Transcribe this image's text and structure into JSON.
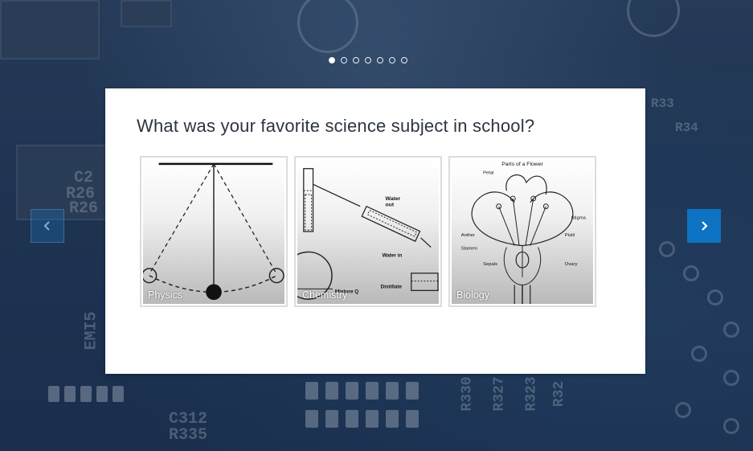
{
  "pager": {
    "count": 7,
    "active_index": 0
  },
  "question": {
    "text": "What was your favorite science subject in school?"
  },
  "choices": [
    {
      "label": "Physics",
      "image": "pendulum-diagram"
    },
    {
      "label": "Chemistry",
      "image": "distillation-apparatus-diagram"
    },
    {
      "label": "Biology",
      "image": "flower-parts-diagram"
    }
  ],
  "chemistry_diagram": {
    "water_out": "Water\nout",
    "water_in": "Water in",
    "distillate": "Distillate",
    "mixture": "Mixture Q"
  },
  "biology_diagram": {
    "title": "Parts of a Flower",
    "petal": "Petal",
    "stigma": "Stigma",
    "anther": "Anther",
    "stamen": "Stamen",
    "sepals": "Sepals",
    "ovary": "Ovary",
    "pistil": "Pistil"
  },
  "nav": {
    "prev_icon": "chevron-left-icon",
    "next_icon": "chevron-right-icon",
    "next_color": "#0d73c2"
  }
}
